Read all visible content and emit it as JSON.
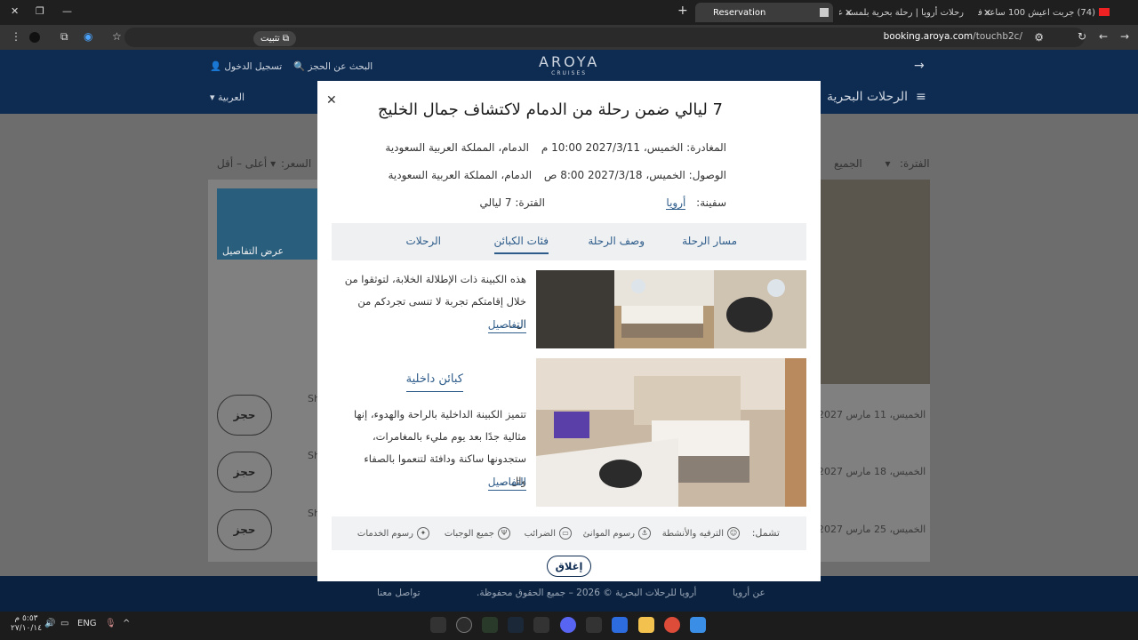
{
  "browser": {
    "tabs": [
      {
        "title": "(74) جربت اعيش 100 ساعة في"
      },
      {
        "title": "رحلات أرويا | رحلة بحرية بلمسة عر"
      },
      {
        "title": "Reservation"
      }
    ],
    "install_label": "تثبيت",
    "url_host": "booking.aroya.com",
    "url_path": "/touchb2c/"
  },
  "site": {
    "logo": "AROYA",
    "logo_sub": "CRUISES",
    "login": "تسجيل الدخول",
    "search_booking": "البحث عن الحجز",
    "nav_cruises": "الرحلات البحرية",
    "language": "العربية"
  },
  "background": {
    "period_label": "الفترة:",
    "period_value": "الجميع",
    "price_label": "السعر:",
    "price_value": "أعلى – أقل",
    "view_details": "عرض التفاصيل",
    "dates": [
      "الخميس، 11 مارس 2027",
      "الخميس، 18 مارس 2027",
      "الخميس، 25 مارس 2027"
    ],
    "book_label": "حجز",
    "ship_short": "Sh"
  },
  "modal": {
    "title": "7 ليالي ضمن رحلة من الدمام لاكتشاف جمال الخليج",
    "departure_label": "المغادرة:",
    "departure_value": "الخميس، 2027/3/11 10:00 م",
    "departure_place": "الدمام، المملكة العربية السعودية",
    "arrival_label": "الوصول:",
    "arrival_value": "الخميس، 2027/3/18 8:00 ص",
    "arrival_place": "الدمام، المملكة العربية السعودية",
    "ship_label": "سفينة:",
    "ship_value": "أرويا",
    "duration_label": "الفترة:",
    "duration_value": "7 ليالي",
    "tabs": [
      "مسار الرحلة",
      "وصف الرحلة",
      "فئات الكبائن",
      "الرحلات"
    ],
    "cabin1_desc": "هذه الكبينة ذات الإطلالة الخلابة، لتوثقوا من خلال إقامتكم تجربة لا تنسى تجردكم من ال...",
    "cabin2_title": "كبائن داخلية",
    "cabin2_desc": "تتميز الكبينة الداخلية بالراحة والهدوء، إنها مثالية جدًا بعد يوم مليء بالمغامرات، ستجدونها ساكنة ودافئة لتنعموا بالصفاء وال...",
    "details_label": "التفاصيل",
    "includes_label": "تشمل:",
    "includes": [
      "الترفيه والأنشطة",
      "رسوم الموانئ",
      "الضرائب",
      "جميع الوجبات",
      "رسوم الخدمات"
    ],
    "close_label": "إغلاق"
  },
  "footer": {
    "about": "عن أرويا",
    "copyright": "أرويا للرحلات البحرية © 2026 – جميع الحقوق محفوظة.",
    "contact": "تواصل معنا"
  },
  "taskbar": {
    "time": "٥:٥٣ م",
    "date": "٢٧/١٠/١٤",
    "lang": "ENG"
  }
}
